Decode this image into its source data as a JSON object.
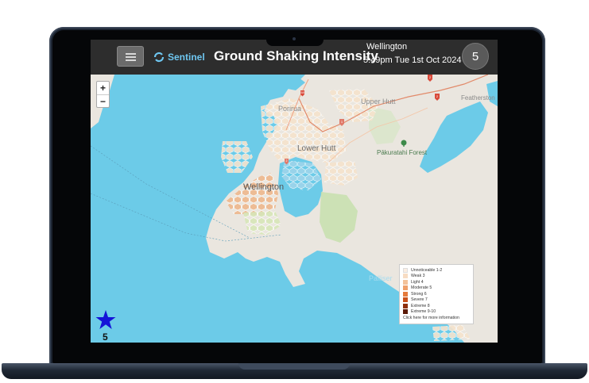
{
  "header": {
    "app_name": "Sentinel",
    "title": "Ground Shaking Intensity",
    "location": "Wellington",
    "datetime": "5:49pm Tue 1st Oct 2024",
    "intensity_badge": "5"
  },
  "map": {
    "zoom_in": "+",
    "zoom_out": "−",
    "labels": {
      "porirua": "Porirua",
      "upper_hutt": "Upper Hutt",
      "featherston": "Featherston",
      "lower_hutt": "Lower Hutt",
      "pakuratahi_forest": "Pākuratahi Forest",
      "wellington": "Wellington",
      "palliser": "Palliser"
    },
    "route_markers": [
      "58",
      "2",
      "2",
      "1",
      "2"
    ],
    "legend": {
      "items": [
        {
          "label": "Unnoticeable 1-2",
          "color": "#fbeee2"
        },
        {
          "label": "Weak 3",
          "color": "#f7dcc3"
        },
        {
          "label": "Light 4",
          "color": "#f3c29a"
        },
        {
          "label": "Moderate 5",
          "color": "#efa06b"
        },
        {
          "label": "Strong 6",
          "color": "#e57a3b"
        },
        {
          "label": "Severe 7",
          "color": "#c9511b"
        },
        {
          "label": "Extreme 8",
          "color": "#8e2f0d"
        },
        {
          "label": "Extreme 9-10",
          "color": "#5a1a06"
        }
      ],
      "footer": "Click here for more information"
    },
    "epicenter_count": "5"
  }
}
